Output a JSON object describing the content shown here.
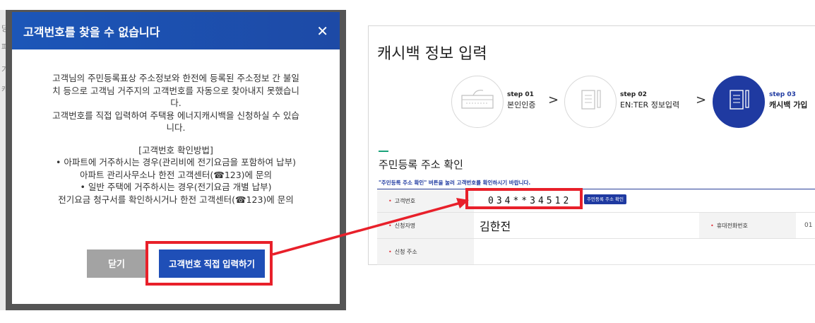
{
  "modal": {
    "title": "고객번호를 찾을 수 없습니다",
    "close_icon": "close-icon",
    "paragraph1": [
      "고객님의 주민등록표상 주소정보와 한전에 등록된 주소정보 간 불일",
      "치 등으로 고객님 거주지의 고객번호를 자동으로 찾아내지 못했습니",
      "다."
    ],
    "paragraph2": [
      "고객번호를 직접 입력하여 주택용 에너지캐시백을 신청하실 수 있습",
      "니다."
    ],
    "method_title": "[고객번호 확인방법]",
    "method_lines": [
      "• 아파트에 거주하시는 경우(관리비에 전기요금을 포함하여 납부)",
      "아파트 관리사무소나 한전 고객센터(☎123)에 문의",
      "• 일반 주택에 거주하시는 경우(전기요금 개별 납부)",
      "전기요금 청구서를 확인하시거나 한전 고객센터(☎123)에 문의"
    ],
    "close_button": "닫기",
    "direct_button": "고객번호 직접 입력하기"
  },
  "panel": {
    "title": "캐시백 정보 입력",
    "steps": [
      {
        "num": "step 01",
        "label": "본인인증",
        "icon": "keyboard-icon"
      },
      {
        "num": "step 02",
        "label": "EN:TER 정보입력",
        "icon": "document-pen-icon"
      },
      {
        "num": "step 03",
        "label": "캐시백 가입",
        "icon": "document-pen-icon"
      }
    ],
    "section_title": "주민등록 주소 확인",
    "notice": "\"주민등록 주소 확인\" 버튼을 눌러 고객번호를 확인하시기 바랍니다.",
    "fields": {
      "customer_no_label": "고객번호",
      "customer_no_value": "034**34512",
      "confirm_button": "주민등록 주소 확인",
      "applicant_label": "신청자명",
      "applicant_value": "김한전",
      "phone_label": "휴대전화번호",
      "phone_value": "01",
      "address_label": "신청 주소"
    }
  },
  "colors": {
    "accent": "#1f3aa1",
    "highlight": "#e8202a",
    "header": "#1c56b8"
  }
}
